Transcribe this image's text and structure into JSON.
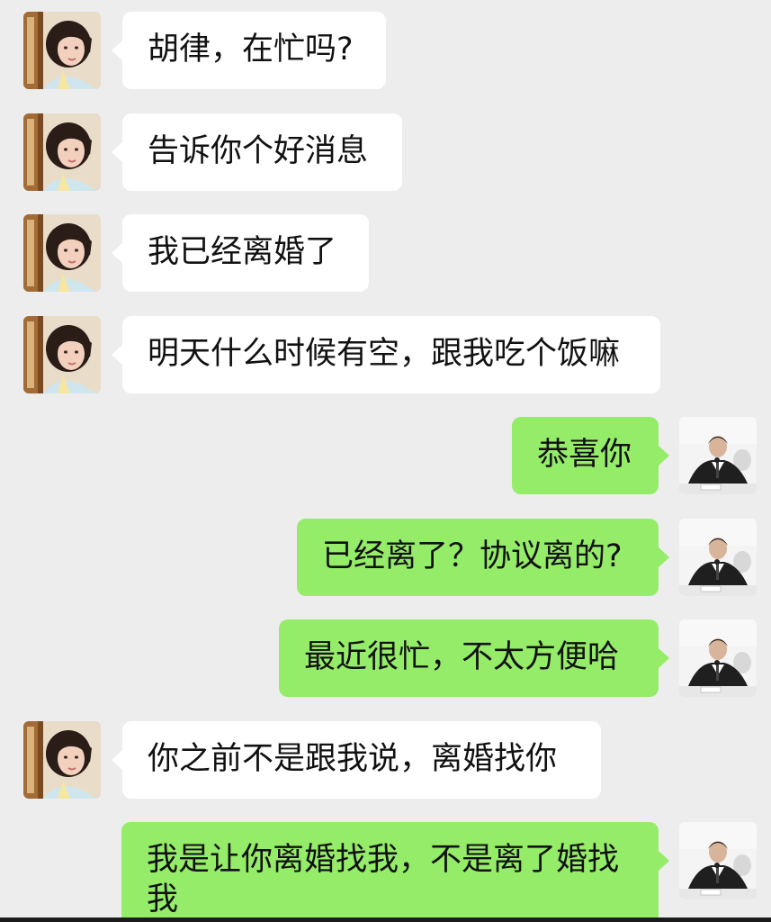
{
  "chat": {
    "colors": {
      "background": "#ededed",
      "received_bubble": "#ffffff",
      "sent_bubble": "#95ec69",
      "text": "#111111"
    },
    "contact_avatar": "woman-portrait-avatar",
    "self_avatar": "man-speaking-at-microphone-avatar",
    "messages": [
      {
        "side": "received",
        "text": "胡律，在忙吗?"
      },
      {
        "side": "received",
        "text": "告诉你个好消息"
      },
      {
        "side": "received",
        "text": "我已经离婚了"
      },
      {
        "side": "received",
        "text": "明天什么时候有空，跟我吃个饭嘛"
      },
      {
        "side": "sent",
        "text": "恭喜你"
      },
      {
        "side": "sent",
        "text": "已经离了？协议离的?"
      },
      {
        "side": "sent",
        "text": "最近很忙，不太方便哈"
      },
      {
        "side": "received",
        "text": "你之前不是跟我说，离婚找你"
      },
      {
        "side": "sent",
        "text": "我是让你离婚找我，不是离了婚找我"
      }
    ]
  }
}
